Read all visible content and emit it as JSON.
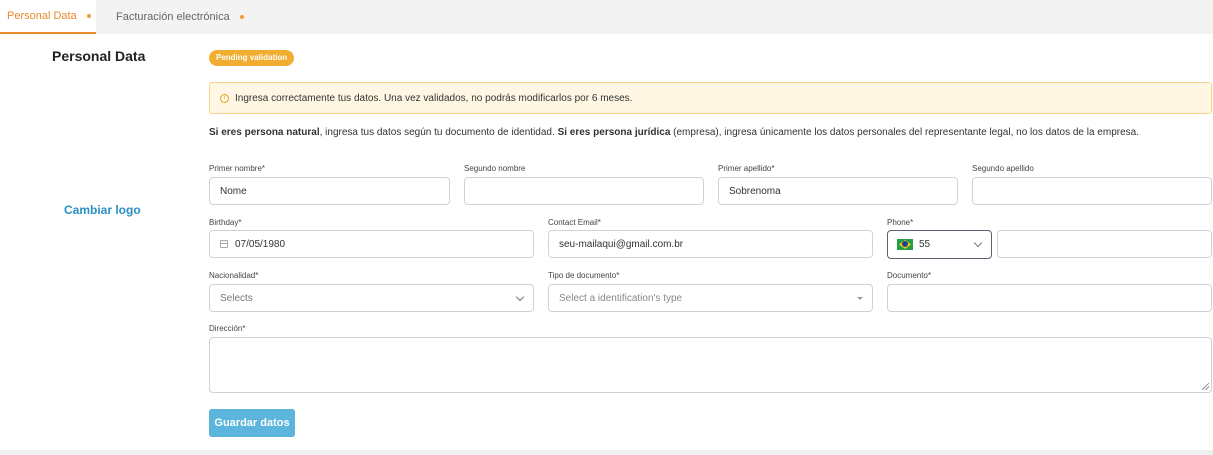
{
  "tabs": [
    {
      "label": "Personal Data",
      "active": true
    },
    {
      "label": "Facturación electrónica",
      "active": false
    }
  ],
  "section": {
    "title": "Personal Data",
    "change_logo": "Cambiar logo",
    "badge": "Pending validation"
  },
  "alert": {
    "text": "Ingresa correctamente tus datos. Una vez validados, no podrás modificarlos por 6 meses."
  },
  "description": {
    "bold1": "Si eres persona natural",
    "text1": ", ingresa tus datos según tu documento de identidad. ",
    "bold2": "Si eres persona jurídica",
    "text2": " (empresa), ingresa únicamente los datos personales del representante legal, no los datos de la empresa."
  },
  "form": {
    "first_name": {
      "label": "Primer nombre*",
      "value": "Nome"
    },
    "second_name": {
      "label": "Segundo nombre",
      "value": ""
    },
    "first_surname": {
      "label": "Primer apellido*",
      "value": "Sobrenoma"
    },
    "second_surname": {
      "label": "Segundo apellido",
      "value": ""
    },
    "birthday": {
      "label": "Birthday*",
      "value": "07/05/1980"
    },
    "email": {
      "label": "Contact Email*",
      "value": "seu-mailaqui@gmail.com.br"
    },
    "phone": {
      "label": "Phone*",
      "code": "55",
      "value": ""
    },
    "nationality": {
      "label": "Nacionalidad*",
      "value": "Selects"
    },
    "doc_type": {
      "label": "Tipo de documento*",
      "placeholder": "Select a identification's type"
    },
    "document": {
      "label": "Documento*",
      "value": ""
    },
    "address": {
      "label": "Dirección*",
      "value": ""
    }
  },
  "actions": {
    "save": "Guardar datos"
  },
  "colors": {
    "accent_orange": "#e98a2d",
    "badge": "#f0ad2f",
    "link_blue": "#2a8fc4",
    "button_blue": "#5bb5dc"
  }
}
